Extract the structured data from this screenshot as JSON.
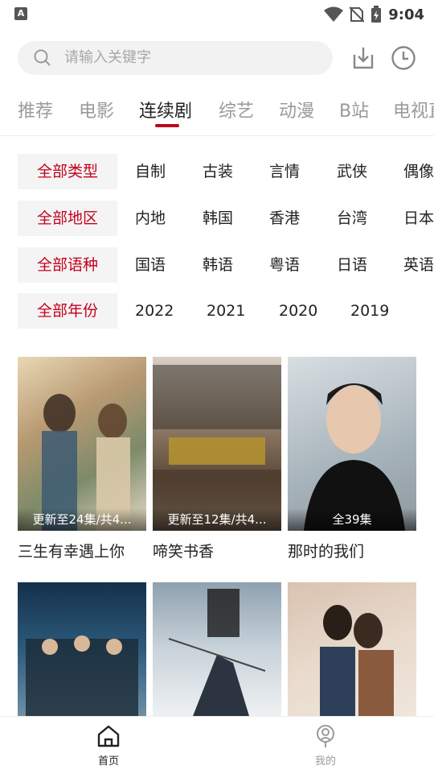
{
  "status_bar": {
    "time": "9:04",
    "left_badge": "A"
  },
  "search": {
    "placeholder": "请输入关键字"
  },
  "tabs": [
    "推荐",
    "电影",
    "连续剧",
    "综艺",
    "动漫",
    "B站",
    "电视直播"
  ],
  "active_tab": "连续剧",
  "filters": {
    "type": {
      "all": "全部类型",
      "options": [
        "自制",
        "古装",
        "言情",
        "武侠",
        "偶像"
      ]
    },
    "region": {
      "all": "全部地区",
      "options": [
        "内地",
        "韩国",
        "香港",
        "台湾",
        "日本"
      ]
    },
    "language": {
      "all": "全部语种",
      "options": [
        "国语",
        "韩语",
        "粤语",
        "日语",
        "英语"
      ]
    },
    "year": {
      "all": "全部年份",
      "options": [
        "2022",
        "2021",
        "2020",
        "2019"
      ]
    }
  },
  "shows": [
    {
      "title": "三生有幸遇上你",
      "badge": "更新至24集/共4..."
    },
    {
      "title": "啼笑书香",
      "badge": "更新至12集/共4..."
    },
    {
      "title": "那时的我们",
      "badge": "全39集"
    },
    {
      "title": "",
      "badge": ""
    },
    {
      "title": "",
      "badge": ""
    },
    {
      "title": "",
      "badge": ""
    }
  ],
  "bottom_nav": {
    "home": "首页",
    "mine": "我的"
  },
  "colors": {
    "accent": "#c0001b",
    "inactive": "#9a9a9a"
  }
}
